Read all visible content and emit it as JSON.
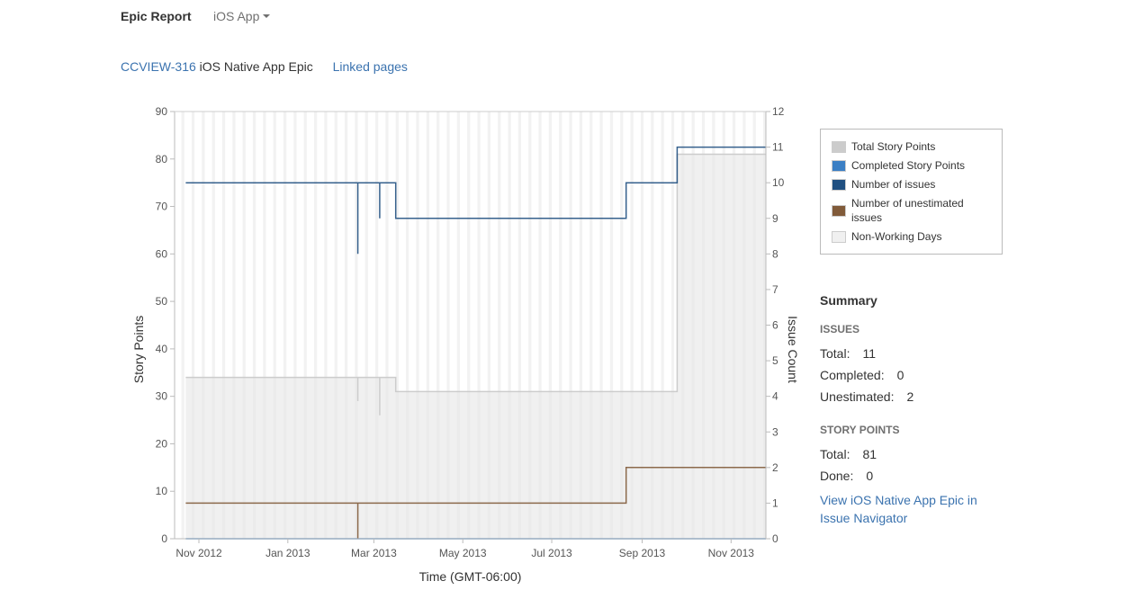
{
  "header": {
    "title": "Epic Report",
    "board_selector": "iOS App"
  },
  "epic": {
    "key": "CCVIEW-316",
    "name": "iOS Native App Epic",
    "linked_pages_label": "Linked pages"
  },
  "legend": {
    "items": [
      {
        "label": "Total Story Points",
        "color": "#cccccc"
      },
      {
        "label": "Completed Story Points",
        "color": "#3b7fc4"
      },
      {
        "label": "Number of issues",
        "color": "#205081"
      },
      {
        "label": "Number of unestimated issues",
        "color": "#815b3a"
      },
      {
        "label": "Non-Working Days",
        "color": "#f0f0f0"
      }
    ]
  },
  "summary": {
    "title": "Summary",
    "issues_heading": "ISSUES",
    "issues_total_label": "Total:",
    "issues_total": "11",
    "issues_completed_label": "Completed:",
    "issues_completed": "0",
    "issues_unestimated_label": "Unestimated:",
    "issues_unestimated": "2",
    "sp_heading": "STORY POINTS",
    "sp_total_label": "Total:",
    "sp_total": "81",
    "sp_done_label": "Done:",
    "sp_done": "0",
    "navigator_link": "View iOS Native App Epic in Issue Navigator"
  },
  "chart_data": {
    "type": "line",
    "title": "",
    "xlabel": "Time (GMT-06:00)",
    "ylabel": "Story Points",
    "y2label": "Issue Count",
    "ylim": [
      0,
      90
    ],
    "y2lim": [
      0,
      12
    ],
    "xlim": [
      "2012-10-15",
      "2013-11-25"
    ],
    "x_ticks": [
      {
        "label": "Nov 2012",
        "date": "2012-11-01"
      },
      {
        "label": "Jan 2013",
        "date": "2013-01-01"
      },
      {
        "label": "Mar 2013",
        "date": "2013-03-01"
      },
      {
        "label": "May 2013",
        "date": "2013-05-01"
      },
      {
        "label": "Jul 2013",
        "date": "2013-07-01"
      },
      {
        "label": "Sep 2013",
        "date": "2013-09-01"
      },
      {
        "label": "Nov 2013",
        "date": "2013-11-01"
      }
    ],
    "y_ticks": [
      0,
      10,
      20,
      30,
      40,
      50,
      60,
      70,
      80,
      90
    ],
    "y2_ticks": [
      0,
      1,
      2,
      3,
      4,
      5,
      6,
      7,
      8,
      9,
      10,
      11,
      12
    ],
    "grid": false,
    "legend_position": "right",
    "series": [
      {
        "name": "Total Story Points",
        "axis": "left",
        "style": "area-step",
        "color": "#cccccc",
        "points": [
          [
            "2012-10-23",
            34
          ],
          [
            "2013-02-18",
            29
          ],
          [
            "2013-02-18",
            34
          ],
          [
            "2013-03-05",
            26
          ],
          [
            "2013-03-05",
            34
          ],
          [
            "2013-03-16",
            31
          ],
          [
            "2013-09-25",
            81
          ],
          [
            "2013-11-25",
            81
          ]
        ]
      },
      {
        "name": "Completed Story Points",
        "axis": "left",
        "style": "step",
        "color": "#3b7fc4",
        "points": [
          [
            "2012-10-23",
            0
          ],
          [
            "2013-11-25",
            0
          ]
        ]
      },
      {
        "name": "Number of issues",
        "axis": "right",
        "style": "step",
        "color": "#205081",
        "points": [
          [
            "2012-10-23",
            10
          ],
          [
            "2013-02-18",
            8
          ],
          [
            "2013-02-18",
            10
          ],
          [
            "2013-03-05",
            9
          ],
          [
            "2013-03-05",
            10
          ],
          [
            "2013-03-16",
            9
          ],
          [
            "2013-08-21",
            10
          ],
          [
            "2013-09-25",
            11
          ],
          [
            "2013-11-25",
            11
          ]
        ]
      },
      {
        "name": "Number of unestimated issues",
        "axis": "right",
        "style": "step",
        "color": "#815b3a",
        "points": [
          [
            "2012-10-23",
            1
          ],
          [
            "2013-02-18",
            0
          ],
          [
            "2013-02-18",
            1
          ],
          [
            "2013-08-21",
            2
          ],
          [
            "2013-11-25",
            2
          ]
        ]
      }
    ],
    "non_working_days": "weekends"
  }
}
